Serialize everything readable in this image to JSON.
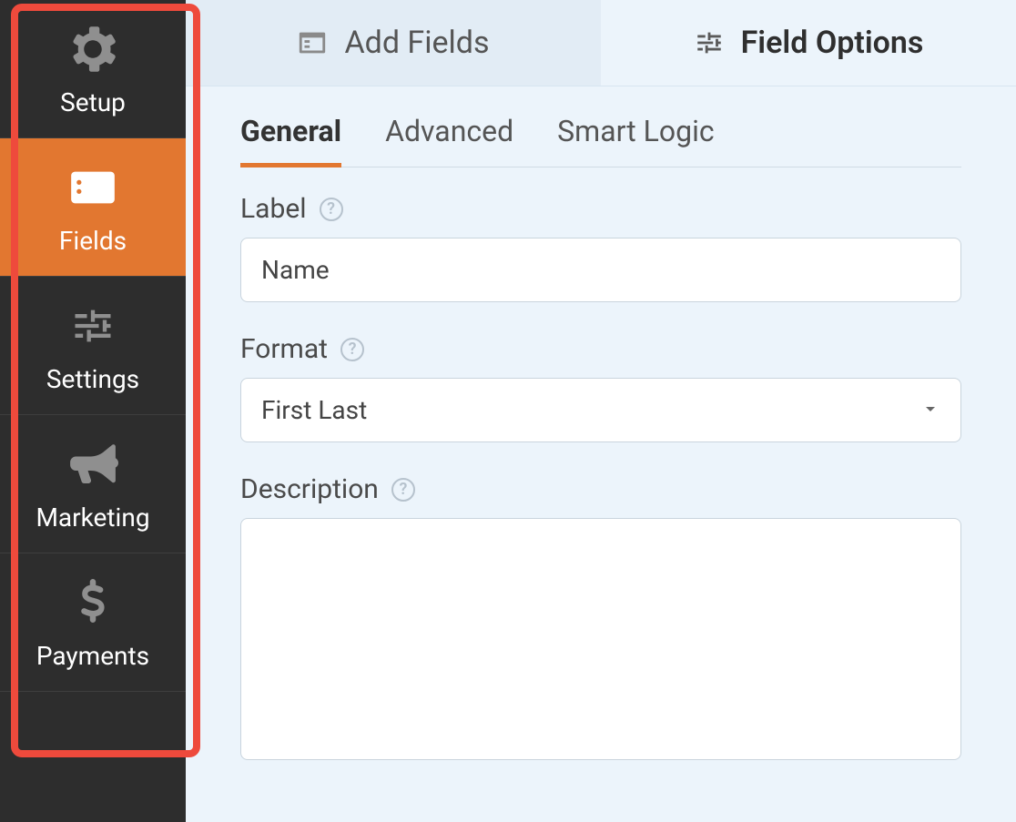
{
  "sidebar": {
    "items": [
      {
        "label": "Setup",
        "icon": "gear-icon",
        "active": false
      },
      {
        "label": "Fields",
        "icon": "list-box-icon",
        "active": true
      },
      {
        "label": "Settings",
        "icon": "sliders-icon",
        "active": false
      },
      {
        "label": "Marketing",
        "icon": "bullhorn-icon",
        "active": false
      },
      {
        "label": "Payments",
        "icon": "dollar-icon",
        "active": false
      }
    ]
  },
  "top_tabs": {
    "add_fields": {
      "label": "Add Fields",
      "active": false
    },
    "field_options": {
      "label": "Field Options",
      "active": true
    }
  },
  "subtabs": {
    "general": {
      "label": "General",
      "active": true
    },
    "advanced": {
      "label": "Advanced",
      "active": false
    },
    "smart_logic": {
      "label": "Smart Logic",
      "active": false
    }
  },
  "form": {
    "label_label": "Label",
    "label_value": "Name",
    "format_label": "Format",
    "format_value": "First Last",
    "description_label": "Description",
    "description_value": ""
  }
}
